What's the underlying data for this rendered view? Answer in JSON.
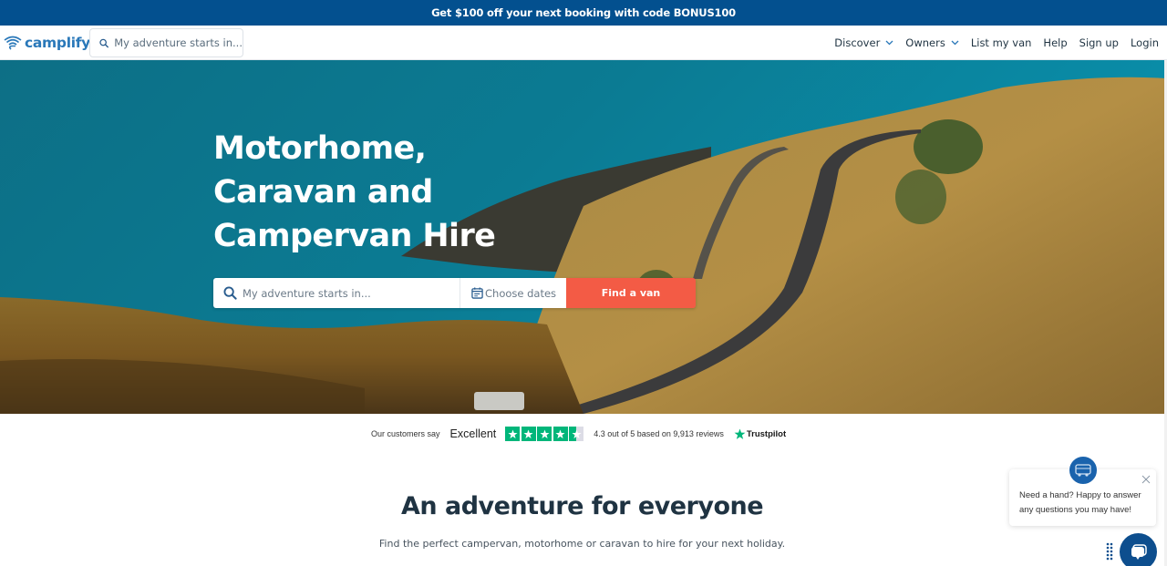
{
  "promo": {
    "text": "Get $100 off your next booking with code BONUS100"
  },
  "nav": {
    "logo_text": "camplify",
    "search_placeholder": "My adventure starts in...",
    "links": [
      {
        "label": "Discover",
        "has_dropdown": true
      },
      {
        "label": "Owners",
        "has_dropdown": true
      },
      {
        "label": "List my van",
        "has_dropdown": false
      },
      {
        "label": "Help",
        "has_dropdown": false
      },
      {
        "label": "Sign up",
        "has_dropdown": false
      },
      {
        "label": "Login",
        "has_dropdown": false
      }
    ]
  },
  "hero": {
    "title_lines": [
      "Motorhome,",
      "Caravan and",
      "Campervan Hire"
    ],
    "search": {
      "location_placeholder": "My adventure starts in...",
      "dates_label": "Choose dates",
      "find_button": "Find a van"
    }
  },
  "trustpilot": {
    "prefix": "Our customers say",
    "rating_word": "Excellent",
    "stars_value": 4.3,
    "stars_max": 5,
    "summary": "4.3 out of 5 based on 9,913 reviews",
    "brand": "Trustpilot"
  },
  "section": {
    "title": "An adventure for everyone",
    "subtitle": "Find the perfect campervan, motorhome or caravan to hire for your next holiday."
  },
  "chat": {
    "message": "Need a hand? Happy to answer any questions you may have!"
  },
  "colors": {
    "promo_bg": "#03508f",
    "brand_blue": "#2a78b9",
    "cta_orange": "#f35b45",
    "trustpilot_green": "#00b67a",
    "heading_dark": "#1f3342",
    "chat_blue": "#0d4e8e"
  }
}
